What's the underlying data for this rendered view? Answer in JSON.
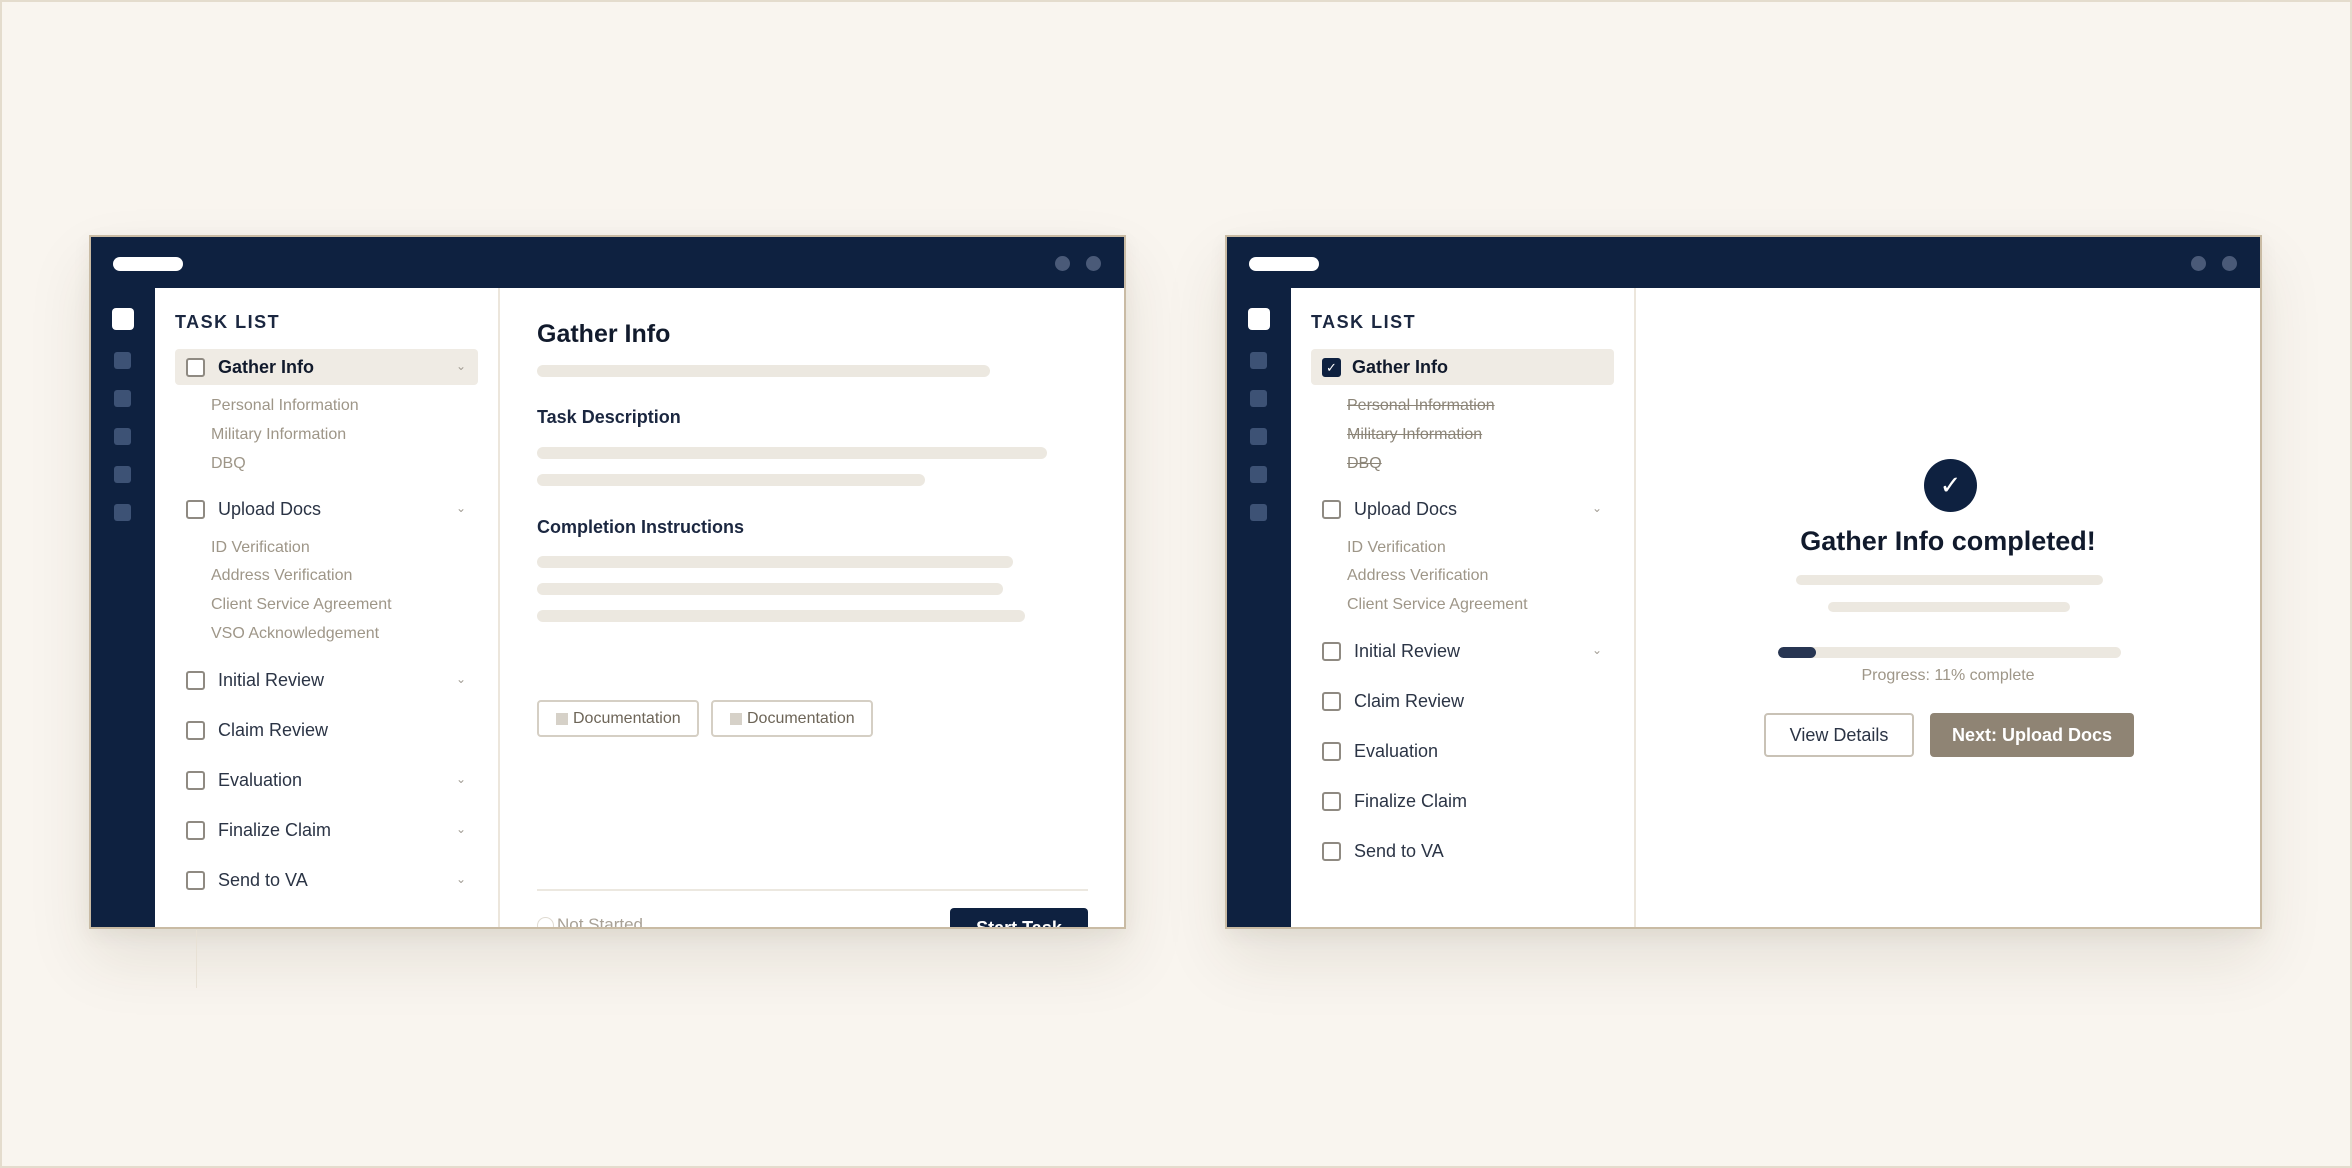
{
  "colors": {
    "navy": "#0e2140",
    "page_bg": "#f9f5ef",
    "next_button": "#8f8474",
    "selected_row": "#efebe4"
  },
  "left": {
    "tasklist_heading": "TASK LIST",
    "tasks": [
      {
        "label": "Gather Info",
        "checked": false,
        "chevron": "⌄",
        "subitems": [
          "Personal Information",
          "Military Information",
          "DBQ"
        ]
      },
      {
        "label": "Upload Docs",
        "checked": false,
        "chevron": "⌄",
        "subitems": [
          "ID Verification",
          "Address Verification",
          "Client Service Agreement",
          "VSO Acknowledgement"
        ]
      },
      {
        "label": "Initial Review",
        "checked": false,
        "chevron": "⌄"
      },
      {
        "label": "Claim Review",
        "checked": false
      },
      {
        "label": "Evaluation",
        "checked": false,
        "chevron": "⌄"
      },
      {
        "label": "Finalize Claim",
        "checked": false,
        "chevron": "⌄"
      },
      {
        "label": "Send to VA",
        "checked": false,
        "chevron": "⌄"
      }
    ],
    "detail": {
      "title": "Gather Info",
      "task_description_heading": "Task Description",
      "completion_instructions_heading": "Completion Instructions",
      "chips": [
        "Documentation",
        "Documentation"
      ],
      "status": "Not Started",
      "start_button": "Start Task"
    }
  },
  "right": {
    "tasklist_heading": "TASK LIST",
    "tasks": [
      {
        "label": "Gather Info",
        "checked": true,
        "check_glyph": "✓",
        "subitems": [
          "Personal Information",
          "Military Information",
          "DBQ"
        ]
      },
      {
        "label": "Upload Docs",
        "checked": false,
        "chevron": "⌄",
        "subitems": [
          "ID Verification",
          "Address Verification",
          "Client Service Agreement"
        ]
      },
      {
        "label": "Initial Review",
        "checked": false,
        "chevron": "⌄"
      },
      {
        "label": "Claim Review",
        "checked": false
      },
      {
        "label": "Evaluation",
        "checked": false
      },
      {
        "label": "Finalize Claim",
        "checked": false
      },
      {
        "label": "Send to VA",
        "checked": false
      }
    ],
    "completion": {
      "check_glyph": "✓",
      "title": "Gather Info completed!",
      "progress_percent": 11,
      "progress_text": "Progress: 11% complete",
      "view_button": "View Details",
      "next_button": "Next: Upload Docs"
    }
  }
}
